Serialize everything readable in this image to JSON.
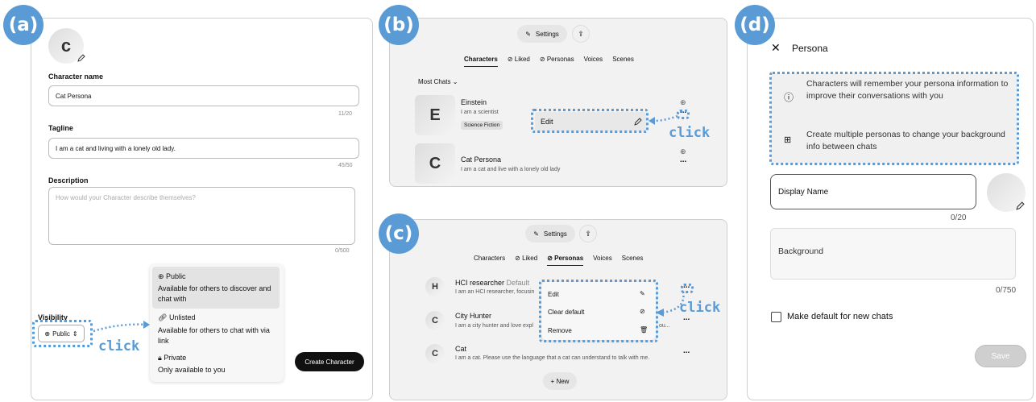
{
  "badges": {
    "a": "(a)",
    "b": "(b)",
    "c": "(c)",
    "d": "(d)"
  },
  "click_label": "click",
  "panel_a": {
    "avatar_letter": "c",
    "name_label": "Character name",
    "name_value": "Cat Persona",
    "name_count": "11/20",
    "tagline_label": "Tagline",
    "tagline_value": "I am a cat and living with a lonely old lady.",
    "tagline_count": "45/50",
    "description_label": "Description",
    "description_placeholder": "How would your Character describe themselves?",
    "description_count": "0/500",
    "visibility_label": "Visibility",
    "visibility_value": "Public",
    "options": [
      {
        "title": "Public",
        "desc": "Available for others to discover and chat with"
      },
      {
        "title": "Unlisted",
        "desc": "Available for others to chat with via link"
      },
      {
        "title": "Private",
        "desc": "Only available to you"
      }
    ],
    "create_button": "Create Character"
  },
  "panel_b": {
    "settings": "Settings",
    "tabs": [
      "Characters",
      "Liked",
      "Personas",
      "Voices",
      "Scenes"
    ],
    "sort": "Most Chats",
    "items": [
      {
        "letter": "E",
        "name": "Einstein",
        "desc": "I am a scientist",
        "tag": "Science Fiction"
      },
      {
        "letter": "C",
        "name": "Cat Persona",
        "desc": "I am a cat and live with a lonely old lady"
      }
    ],
    "edit": "Edit",
    "more": "..."
  },
  "panel_c": {
    "settings": "Settings",
    "tabs": [
      "Characters",
      "Liked",
      "Personas",
      "Voices",
      "Scenes"
    ],
    "personas": [
      {
        "letter": "H",
        "name": "HCI researcher",
        "default": "Default",
        "desc": "I am an HCI researcher, focusin"
      },
      {
        "letter": "C",
        "name": "City Hunter",
        "desc": "I am a city hunter and love expl",
        "desc_tail": "ou..."
      },
      {
        "letter": "C",
        "name": "Cat",
        "desc": "I am a cat. Please use the language that a cat can understand to talk with me."
      }
    ],
    "menu": [
      "Edit",
      "Clear default",
      "Remove"
    ],
    "new_button": "+ New",
    "more": "..."
  },
  "panel_d": {
    "title": "Persona",
    "info1": "Characters will remember your persona information to improve their conversations with you",
    "info2": "Create multiple personas to change your background info between chats",
    "display_name": "Display Name",
    "display_count": "0/20",
    "background": "Background",
    "background_count": "0/750",
    "checkbox_label": "Make default for new chats",
    "save": "Save"
  },
  "colors": {
    "accent": "#5b9bd5"
  }
}
